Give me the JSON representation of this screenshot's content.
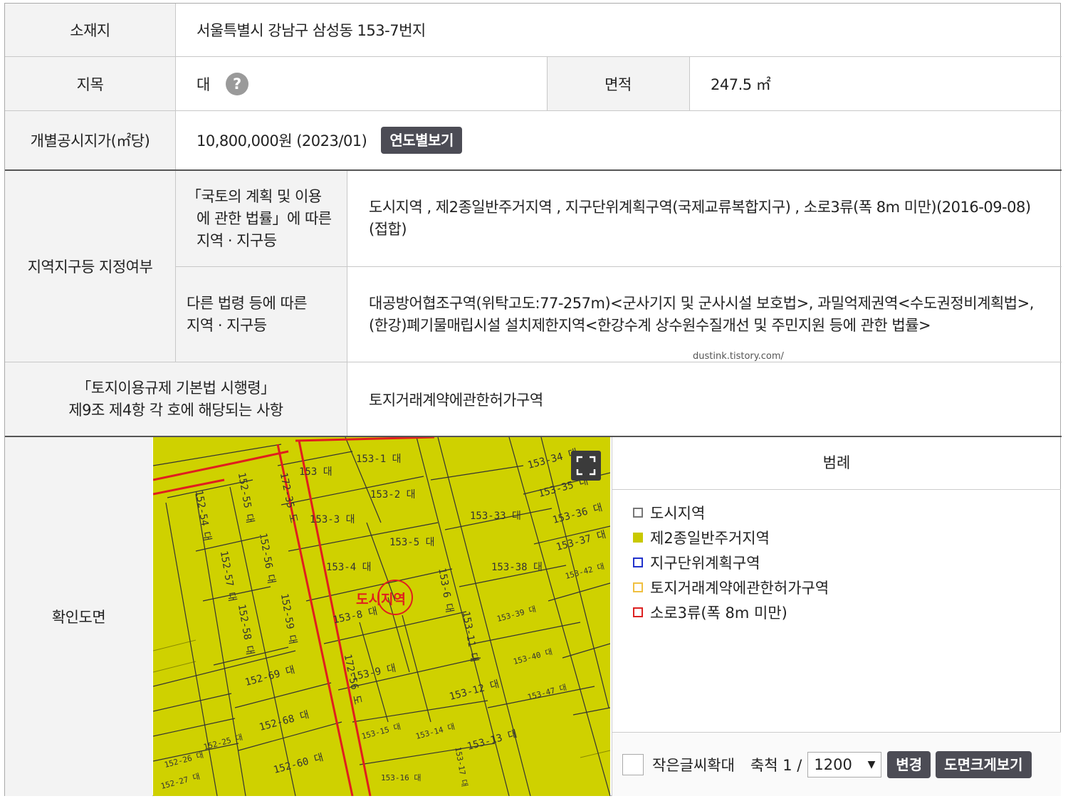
{
  "rows": {
    "location": {
      "label": "소재지",
      "value": "서울특별시 강남구 삼성동 153-7번지"
    },
    "jimok": {
      "label": "지목",
      "value": "대",
      "help": "?"
    },
    "area": {
      "label": "면적",
      "value": "247.5 ㎡"
    },
    "price": {
      "label": "개별공시지가(㎡당)",
      "value": "10,800,000원 (2023/01)",
      "button": "연도별보기"
    },
    "zoning": {
      "label": "지역지구등 지정여부",
      "sub1": {
        "label_l1": "「국토의 계획 및 이용",
        "label_l2": "에 관한 법률」에 따른",
        "label_l3": "지역 · 지구등",
        "value": "도시지역 , 제2종일반주거지역 , 지구단위계획구역(국제교류복합지구) , 소로3류(폭 8m 미만)(2016-09-08)(접합)"
      },
      "sub2": {
        "label_l1": "다른 법령 등에 따른",
        "label_l2": "지역 · 지구등",
        "value": "대공방어협조구역(위탁고도:77-257m)<군사기지 및 군사시설 보호법>, 과밀억제권역<수도권정비계획법>, (한강)폐기물매립시설 설치제한지역<한강수계 상수원수질개선 및 주민지원 등에 관한 법률>"
      }
    },
    "enforcement": {
      "label_l1": "「토지이용규제 기본법 시행령」",
      "label_l2": "제9조 제4항 각 호에 해당되는 사항",
      "value": "토지거래계약에관한허가구역"
    },
    "map": {
      "label": "확인도면"
    }
  },
  "watermark": "dustink.tistory.com/",
  "legend": {
    "title": "범례",
    "items": [
      {
        "label": "도시지역",
        "border": "#777777",
        "fill": "#ffffff"
      },
      {
        "label": "제2종일반주거지역",
        "border": "#c9c900",
        "fill": "#c9c900"
      },
      {
        "label": "지구단위계획구역",
        "border": "#2233cc",
        "fill": "#ffffff"
      },
      {
        "label": "토지거래계약에관한허가구역",
        "border": "#f0c040",
        "fill": "#ffffff"
      },
      {
        "label": "소로3류(폭 8m 미만)",
        "border": "#dd2222",
        "fill": "#ffffff"
      }
    ]
  },
  "controls": {
    "enlarge_label": "작은글씨확대",
    "scale_label": "축척 1 /",
    "scale_value": "1200",
    "change_button": "변경",
    "bigview_button": "도면크게보기"
  },
  "map": {
    "fill_color": "#cfd100",
    "center_label": "도시지역",
    "lots": [
      "153 대",
      "153-1 대",
      "153-2 대",
      "153-3 대",
      "153-5 대",
      "153-4 대",
      "153-8 대",
      "153-9 대",
      "153-33 대",
      "153-38 대",
      "153-36 대",
      "153-37 대",
      "153-12 대",
      "153-13 대",
      "152-69 대",
      "152-68 대",
      "152-60 대",
      "152-54 대",
      "152-55 대",
      "152-57 대",
      "152-56 대",
      "152-58 대",
      "152-59 대",
      "172-35 도",
      "172-56 도",
      "153-34 대",
      "153-35 대",
      "153-11 대",
      "153-6 대",
      "153-39 대",
      "153-40 대",
      "153-42 대",
      "153-47 대",
      "153-15 대",
      "153-14 대",
      "153-16 대",
      "153-17 대",
      "152-27 대",
      "152-26 대",
      "152-25 대"
    ]
  }
}
